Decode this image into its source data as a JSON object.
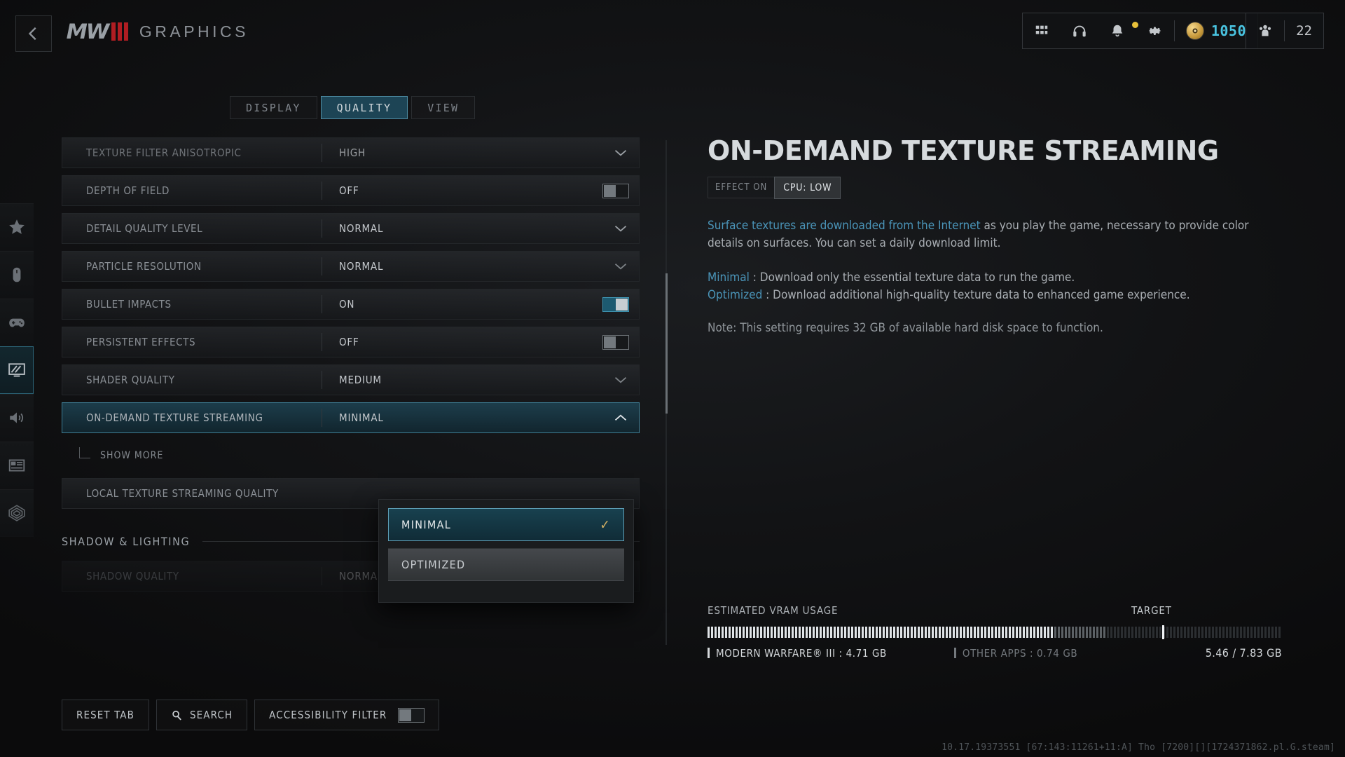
{
  "header": {
    "back_icon": "chevron-left-icon",
    "logo_text": "MW",
    "logo_bars": 3,
    "title": "GRAPHICS"
  },
  "hud": {
    "grid_icon": "grid-icon",
    "headset_icon": "headphones-icon",
    "bell_icon": "bell-icon",
    "gear_icon": "gear-icon",
    "coin_icon": "coin-icon",
    "currency": "1050",
    "squad_icon": "squad-icon",
    "squad_count": "22"
  },
  "rail": [
    {
      "name": "favorites",
      "icon": "star-icon",
      "active": false
    },
    {
      "name": "mouse-keyboard",
      "icon": "mouse-icon",
      "active": false
    },
    {
      "name": "controller",
      "icon": "gamepad-icon",
      "active": false
    },
    {
      "name": "graphics",
      "icon": "monitor-icon",
      "active": true
    },
    {
      "name": "audio",
      "icon": "speaker-icon",
      "active": false
    },
    {
      "name": "interface",
      "icon": "layout-icon",
      "active": false
    },
    {
      "name": "account",
      "icon": "radar-icon",
      "active": false
    }
  ],
  "tabs": [
    {
      "label": "DISPLAY",
      "active": false
    },
    {
      "label": "QUALITY",
      "active": true
    },
    {
      "label": "VIEW",
      "active": false
    }
  ],
  "settings": [
    {
      "label": "TEXTURE FILTER ANISOTROPIC",
      "value": "HIGH",
      "control": "dropdown",
      "state": "dim"
    },
    {
      "label": "DEPTH OF FIELD",
      "value": "OFF",
      "control": "toggle",
      "toggle_on": false
    },
    {
      "label": "DETAIL QUALITY LEVEL",
      "value": "NORMAL",
      "control": "dropdown"
    },
    {
      "label": "PARTICLE RESOLUTION",
      "value": "NORMAL",
      "control": "dropdown"
    },
    {
      "label": "BULLET IMPACTS",
      "value": "ON",
      "control": "toggle",
      "toggle_on": true
    },
    {
      "label": "PERSISTENT EFFECTS",
      "value": "OFF",
      "control": "toggle",
      "toggle_on": false
    },
    {
      "label": "SHADER QUALITY",
      "value": "MEDIUM",
      "control": "dropdown"
    },
    {
      "label": "ON-DEMAND TEXTURE STREAMING",
      "value": "MINIMAL",
      "control": "dropdown",
      "selected": true,
      "expanded": true
    }
  ],
  "subrow": {
    "label": "SHOW MORE"
  },
  "settings_after": [
    {
      "label": "LOCAL TEXTURE STREAMING QUALITY",
      "value": "",
      "control": "none"
    }
  ],
  "section": {
    "label": "SHADOW & LIGHTING"
  },
  "partial_row": {
    "label": "SHADOW QUALITY",
    "value": "NORMAL"
  },
  "dropdown": {
    "options": [
      {
        "label": "MINIMAL",
        "selected": true,
        "check": "✓"
      },
      {
        "label": "OPTIMIZED",
        "selected": false,
        "check": ""
      }
    ]
  },
  "detail": {
    "title": "ON-DEMAND TEXTURE STREAMING",
    "effect_label": "EFFECT ON",
    "cpu_badge": "CPU: LOW",
    "desc_highlight": "Surface textures are downloaded from the Internet",
    "desc_rest": " as you play the game, necessary to provide color details on surfaces. You can set a daily download limit.",
    "minimal_key": "Minimal",
    "minimal_text": " : Download only the essential texture data to run the game.",
    "optimized_key": "Optimized",
    "optimized_text": " : Download additional high-quality texture data to enhanced game experience.",
    "note": "Note: This setting requires 32 GB of available hard disk space to function."
  },
  "vram": {
    "title": "ESTIMATED VRAM USAGE",
    "target_label": "TARGET",
    "game_legend": "MODERN WARFARE® III : 4.71 GB",
    "other_legend": "OTHER APPS : 0.74 GB",
    "total": "5.46 / 7.83 GB",
    "game_gb": 4.71,
    "other_gb": 0.74,
    "total_gb": 7.83,
    "target_gb": 6.2
  },
  "bottom": {
    "reset_label": "RESET TAB",
    "search_icon": "search-icon",
    "search_label": "SEARCH",
    "accessibility_label": "ACCESSIBILITY FILTER",
    "accessibility_on": false
  },
  "build": "10.17.19373551 [67:143:11261+11:A] Tho [7200][][1724371862.pl.G.steam]",
  "colors": {
    "accent": "#3f93b0",
    "accent_bg": "#1d4455",
    "gold": "#d3b064",
    "currency": "#49c3e0",
    "red": "#b01d22"
  }
}
